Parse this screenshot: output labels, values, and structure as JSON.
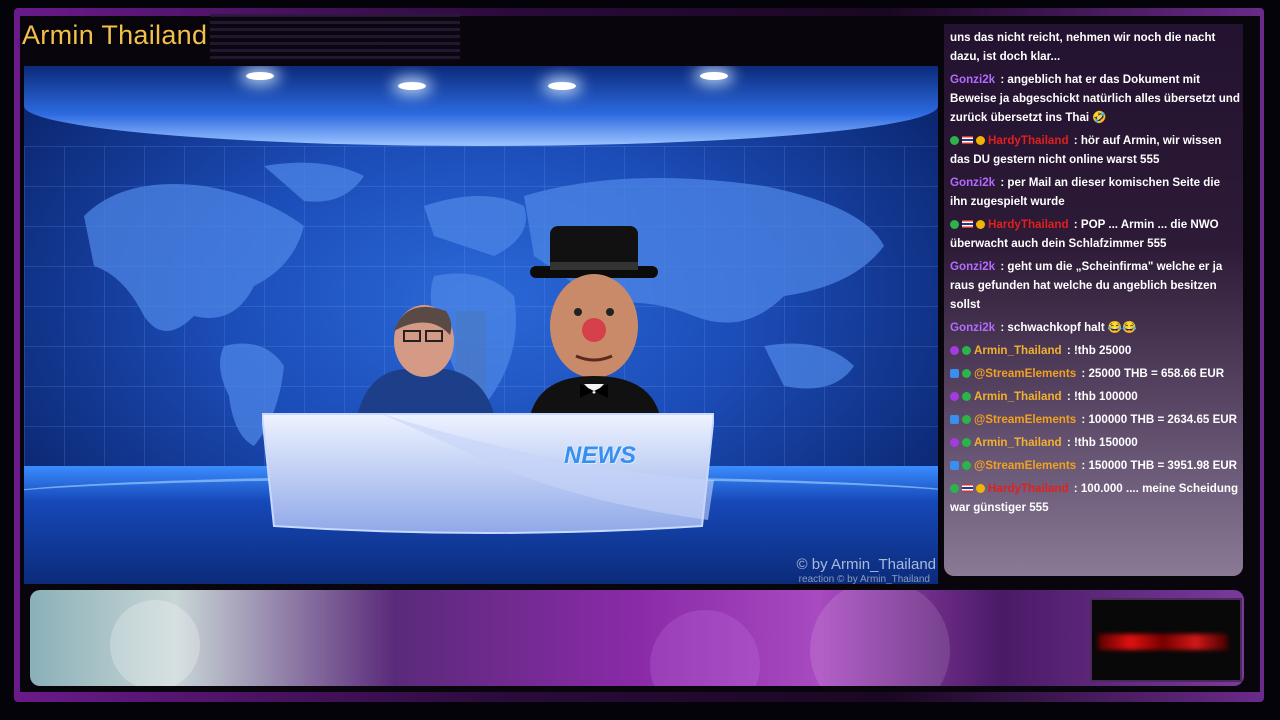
{
  "header": {
    "title": "Armin Thailand"
  },
  "studio": {
    "desk_label": "NEWS",
    "copyright": "© by Armin_Thailand",
    "reaction_credit": "reaction  © by Armin_Thailand"
  },
  "chat": {
    "messages": [
      {
        "user": "",
        "text": "uns das nicht reicht, nehmen wir noch die nacht dazu, ist doch klar...",
        "color": "#ffffff"
      },
      {
        "user": "Gonzi2k",
        "text": ": angeblich hat er das Dokument mit Beweise ja abgeschickt natürlich alles übersetzt und zurück übersetzt ins Thai 🤣",
        "color": "#b36bff"
      },
      {
        "user": "HardyThailand",
        "text": ": hör auf Armin, wir wissen das DU gestern nicht online warst 555",
        "color": "#e02020"
      },
      {
        "user": "Gonzi2k",
        "text": ": per Mail an dieser komischen Seite die ihn zugespielt wurde",
        "color": "#b36bff"
      },
      {
        "user": "HardyThailand",
        "text": ": POP ... Armin ... die NWO überwacht auch dein Schlafzimmer 555",
        "color": "#e02020"
      },
      {
        "user": "Gonzi2k",
        "text": ": geht um die „Scheinfirma\" welche er ja raus gefunden hat welche du angeblich besitzen sollst",
        "color": "#b36bff"
      },
      {
        "user": "Gonzi2k",
        "text": ": schwachkopf halt 😂😂",
        "color": "#b36bff"
      },
      {
        "user": "Armin_Thailand",
        "text": ": !thb 25000",
        "color": "#f2b030"
      },
      {
        "user": "@StreamElements",
        "text": ": 25000 THB = 658.66 EUR",
        "color": "#f2a020"
      },
      {
        "user": "Armin_Thailand",
        "text": ": !thb 100000",
        "color": "#f2b030"
      },
      {
        "user": "@StreamElements",
        "text": ": 100000 THB = 2634.65 EUR",
        "color": "#f2a020"
      },
      {
        "user": "Armin_Thailand",
        "text": ": !thb 150000",
        "color": "#f2b030"
      },
      {
        "user": "@StreamElements",
        "text": ": 150000 THB = 3951.98 EUR",
        "color": "#f2a020"
      },
      {
        "user": "HardyThailand",
        "text": ": 100.000 .... meine Scheidung war günstiger 555",
        "color": "#e02020"
      }
    ]
  }
}
